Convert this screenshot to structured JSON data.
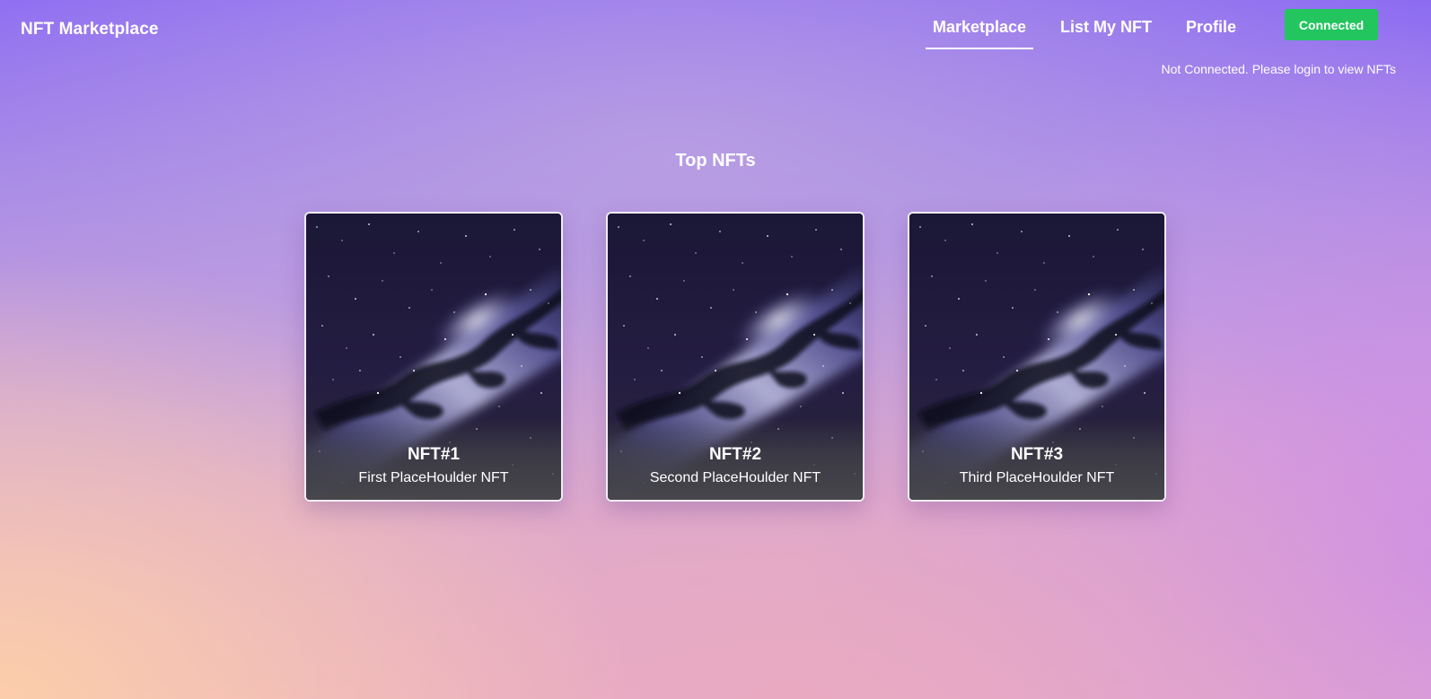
{
  "header": {
    "brand": "NFT Marketplace",
    "nav": [
      {
        "label": "Marketplace",
        "active": true
      },
      {
        "label": "List My NFT",
        "active": false
      },
      {
        "label": "Profile",
        "active": false
      }
    ],
    "connect_button": "Connected",
    "status_text": "Not Connected. Please login to view NFTs"
  },
  "main": {
    "section_title": "Top NFTs",
    "cards": [
      {
        "title": "NFT#1",
        "description": "First PlaceHoulder NFT",
        "image": "milky-way-galaxy"
      },
      {
        "title": "NFT#2",
        "description": "Second PlaceHoulder NFT",
        "image": "milky-way-galaxy"
      },
      {
        "title": "NFT#3",
        "description": "Third PlaceHoulder NFT",
        "image": "milky-way-galaxy"
      }
    ]
  },
  "colors": {
    "connect_button": "#22c55e",
    "text": "#ffffff",
    "card_border": "#f1ecf6"
  }
}
